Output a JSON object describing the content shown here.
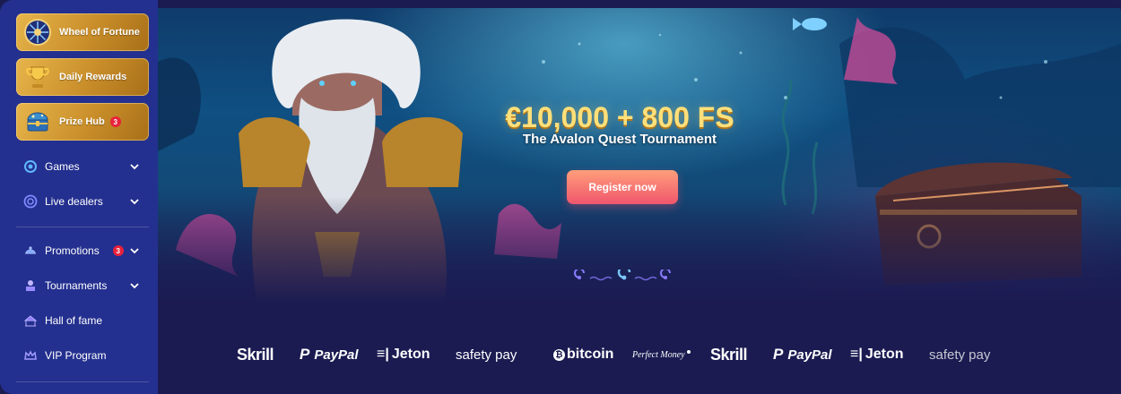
{
  "sidebar": {
    "promos": [
      {
        "label": "Wheel of Fortune",
        "icon": "wheel-of-fortune-icon"
      },
      {
        "label": "Daily Rewards",
        "icon": "trophy-icon"
      },
      {
        "label": "Prize Hub",
        "icon": "treasure-chest-icon",
        "badge": "3"
      }
    ],
    "nav": [
      {
        "label": "Games",
        "icon": "games-icon",
        "expandable": true
      },
      {
        "label": "Live dealers",
        "icon": "live-dealers-icon",
        "expandable": true
      },
      {
        "label": "Promotions",
        "icon": "promotions-icon",
        "expandable": true,
        "badge": "3"
      },
      {
        "label": "Tournaments",
        "icon": "tournaments-icon",
        "expandable": true
      },
      {
        "label": "Hall of fame",
        "icon": "hall-of-fame-icon",
        "expandable": false
      },
      {
        "label": "VIP Program",
        "icon": "crown-icon",
        "expandable": false
      }
    ]
  },
  "hero": {
    "title": "€10,000 + 800 FS",
    "subtitle": "The Avalon Quest Tournament",
    "cta_label": "Register now",
    "slides": 3,
    "active_slide": 2
  },
  "payments": [
    {
      "name": "Skrill"
    },
    {
      "name": "PayPal"
    },
    {
      "name": "Jeton"
    },
    {
      "name": "safety pay"
    },
    {
      "name": "bitcoin"
    },
    {
      "name": "Perfect Money"
    },
    {
      "name": "Skrill"
    },
    {
      "name": "PayPal"
    },
    {
      "name": "Jeton"
    },
    {
      "name": "safety pay"
    }
  ],
  "colors": {
    "sidebar": "#24308f",
    "page_bg": "#1b1b52",
    "promo_gold": "#d49a32",
    "badge": "#e8213b",
    "cta_top": "#ff9e7a",
    "cta_bottom": "#f0566d",
    "title_gold": "#ffe07a"
  }
}
